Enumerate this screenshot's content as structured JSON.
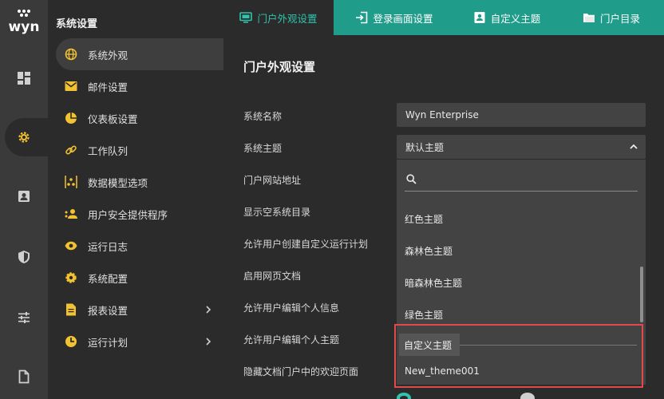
{
  "app": {
    "logo_text": "wyn"
  },
  "sidebar": {
    "title": "系统设置",
    "items": [
      {
        "label": "系统外观",
        "icon": "globe-icon"
      },
      {
        "label": "邮件设置",
        "icon": "mail-icon"
      },
      {
        "label": "仪表板设置",
        "icon": "pie-chart-icon"
      },
      {
        "label": "工作队列",
        "icon": "link-icon"
      },
      {
        "label": "数据模型选项",
        "icon": "data-model-icon"
      },
      {
        "label": "用户安全提供程序",
        "icon": "users-icon"
      },
      {
        "label": "运行日志",
        "icon": "eye-icon"
      },
      {
        "label": "系统配置",
        "icon": "gear-icon"
      },
      {
        "label": "报表设置",
        "icon": "report-icon"
      },
      {
        "label": "运行计划",
        "icon": "schedule-icon"
      }
    ]
  },
  "tabs": [
    {
      "label": "门户外观设置",
      "icon": "monitor-icon"
    },
    {
      "label": "登录画面设置",
      "icon": "login-icon"
    },
    {
      "label": "自定义主题",
      "icon": "theme-icon"
    },
    {
      "label": "门户目录",
      "icon": "folder-icon"
    }
  ],
  "main": {
    "title": "门户外观设置",
    "labels": [
      "系统名称",
      "系统主题",
      "门户网站地址",
      "显示空系统目录",
      "允许用户创建自定义运行计划",
      "启用网页文档",
      "允许用户编辑个人信息",
      "允许用户编辑个人主题",
      "隐藏文档门户中的欢迎页面"
    ],
    "system_name_value": "Wyn Enterprise",
    "system_theme_value": "默认主题",
    "theme_options": [
      "红色主题",
      "森林色主题",
      "暗森林色主题",
      "绿色主题",
      "自定义主题",
      "New_theme001"
    ]
  },
  "colors": {
    "accent": "#1f9c8a",
    "accent_text": "#2ec4ad",
    "highlight": "#e24a4a"
  }
}
